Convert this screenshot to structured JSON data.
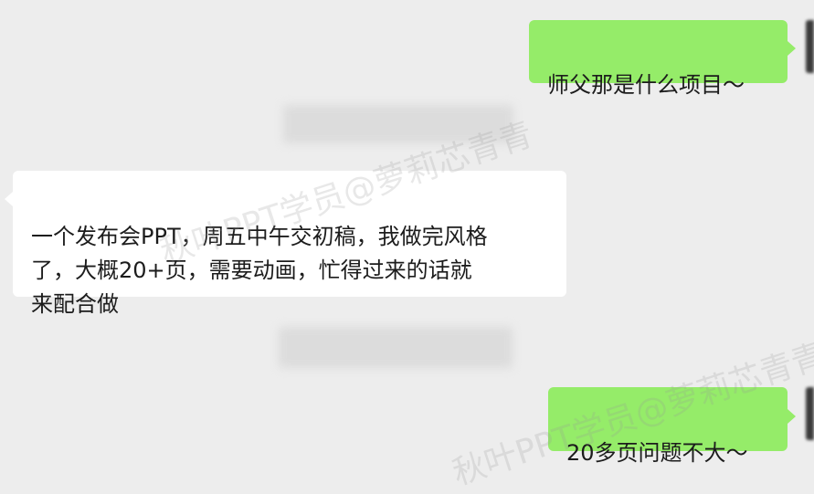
{
  "chat": {
    "messages": [
      {
        "sender": "self",
        "text": "师父那是什么项目～"
      },
      {
        "sender": "other",
        "text": "一个发布会PPT，周五中午交初稿，我做完风格\n了，大概20+页，需要动画，忙得过来的话就\n来配合做"
      },
      {
        "sender": "self",
        "text": "20多页问题不大～"
      }
    ]
  },
  "watermarks": [
    "秋叶PPT学员@萝莉芯青青",
    "秋叶PPT学员@萝莉芯青青"
  ],
  "colors": {
    "background": "#ededed",
    "outgoing_bubble": "#95ec69",
    "incoming_bubble": "#ffffff"
  }
}
